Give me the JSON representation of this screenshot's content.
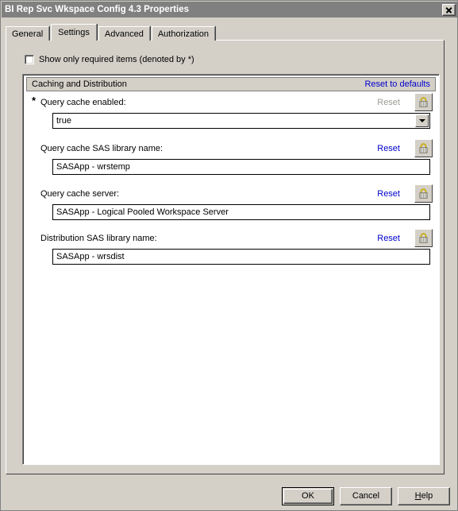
{
  "window": {
    "title": "BI Rep Svc Wkspace Config 4.3 Properties",
    "close_icon": "close-icon"
  },
  "tabs": [
    {
      "label": "General",
      "selected": false
    },
    {
      "label": "Settings",
      "selected": true
    },
    {
      "label": "Advanced",
      "selected": false
    },
    {
      "label": "Authorization",
      "selected": false
    }
  ],
  "options": {
    "show_only_required_label": "Show only required items (denoted by *)",
    "show_only_required_checked": false
  },
  "group": {
    "title": "Caching and Distribution",
    "reset_to_defaults_label": "Reset to defaults",
    "link_color": "#0000cc"
  },
  "fields": [
    {
      "required_marker": "*",
      "label": "Query cache enabled:",
      "reset_label": "Reset",
      "reset_enabled": false,
      "lock_icon": "lock-icon",
      "value": "true",
      "control": "combobox",
      "dropdown_icon": "chevron-down-icon"
    },
    {
      "required_marker": "",
      "label": "Query cache SAS library name:",
      "reset_label": "Reset",
      "reset_enabled": true,
      "lock_icon": "lock-icon",
      "value": "SASApp - wrstemp",
      "control": "textbox",
      "dropdown_icon": ""
    },
    {
      "required_marker": "",
      "label": "Query cache server:",
      "reset_label": "Reset",
      "reset_enabled": true,
      "lock_icon": "lock-icon",
      "value": "SASApp - Logical Pooled Workspace Server",
      "control": "textbox",
      "dropdown_icon": ""
    },
    {
      "required_marker": "",
      "label": "Distribution SAS library name:",
      "reset_label": "Reset",
      "reset_enabled": true,
      "lock_icon": "lock-icon",
      "value": "SASApp - wrsdist",
      "control": "textbox",
      "dropdown_icon": ""
    }
  ],
  "buttons": {
    "ok": "OK",
    "cancel": "Cancel",
    "help_prefix": "H",
    "help_rest": "elp"
  }
}
